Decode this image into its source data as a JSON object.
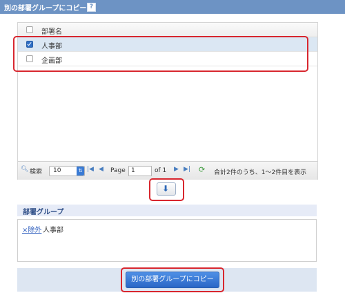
{
  "header": {
    "title": "別の部署グループにコピー",
    "help_glyph": "?"
  },
  "grid": {
    "column_header": "部署名",
    "rows": [
      {
        "label": "人事部",
        "checked": true,
        "selected": true
      },
      {
        "label": "企画部",
        "checked": false,
        "selected": false
      }
    ],
    "pager": {
      "search_label": "検索",
      "page_size": "10",
      "page_label": "Page",
      "page_value": "1",
      "of_label": "of 1",
      "summary": "合計2件のうち、1〜2件目を表示"
    }
  },
  "group_section": {
    "title": "部署グループ",
    "remove_label": "×除外",
    "items": [
      "人事部"
    ]
  },
  "actions": {
    "copy_button": "別の部署グループにコピー"
  },
  "colors": {
    "header_bg": "#6d93c4",
    "accent": "#2f6fc6",
    "highlight": "#d8262e"
  }
}
